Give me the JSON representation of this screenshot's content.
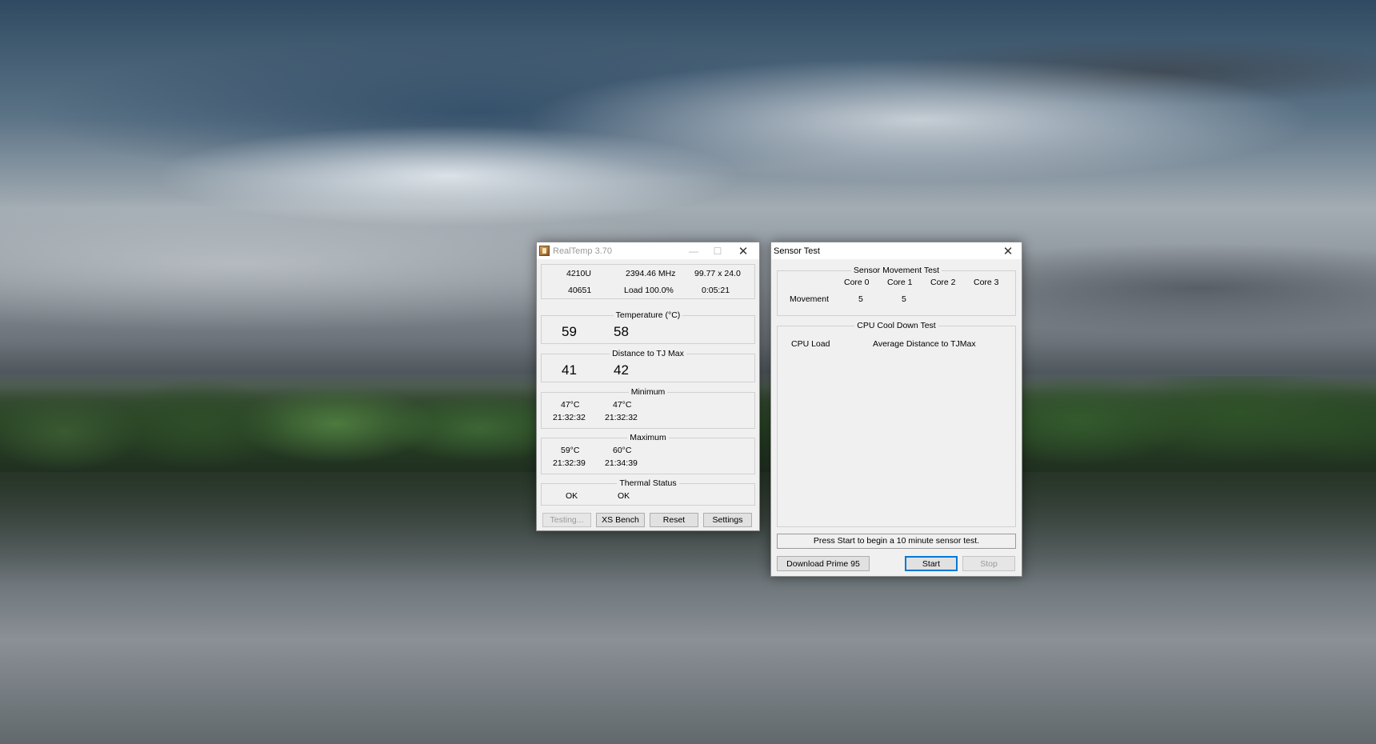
{
  "realtemp": {
    "title": "RealTemp 3.70",
    "info": {
      "cpu_model": "4210U",
      "frequency": "2394.46 MHz",
      "multiplier": "99.77 x 24.0",
      "vid": "40651",
      "load": "Load 100.0%",
      "uptime": "0:05:21"
    },
    "temperature": {
      "label": "Temperature (°C)",
      "core0": "59",
      "core1": "58"
    },
    "distance": {
      "label": "Distance to TJ Max",
      "core0": "41",
      "core1": "42"
    },
    "minimum": {
      "label": "Minimum",
      "core0_temp": "47°C",
      "core1_temp": "47°C",
      "core0_time": "21:32:32",
      "core1_time": "21:32:32"
    },
    "maximum": {
      "label": "Maximum",
      "core0_temp": "59°C",
      "core1_temp": "60°C",
      "core0_time": "21:32:39",
      "core1_time": "21:34:39"
    },
    "thermal": {
      "label": "Thermal Status",
      "core0": "OK",
      "core1": "OK"
    },
    "buttons": {
      "testing": "Testing...",
      "xs_bench": "XS Bench",
      "reset": "Reset",
      "settings": "Settings"
    }
  },
  "sensor_test": {
    "title": "Sensor Test",
    "movement": {
      "label": "Sensor Movement Test",
      "cores": [
        "Core 0",
        "Core 1",
        "Core 2",
        "Core 3"
      ],
      "row_label": "Movement",
      "values": [
        "5",
        "5"
      ]
    },
    "cooldown": {
      "label": "CPU Cool Down Test",
      "col1": "CPU Load",
      "col2": "Average Distance to TJMax"
    },
    "status": "Press Start to begin a 10 minute sensor test.",
    "buttons": {
      "download": "Download Prime 95",
      "start": "Start",
      "stop": "Stop"
    }
  }
}
